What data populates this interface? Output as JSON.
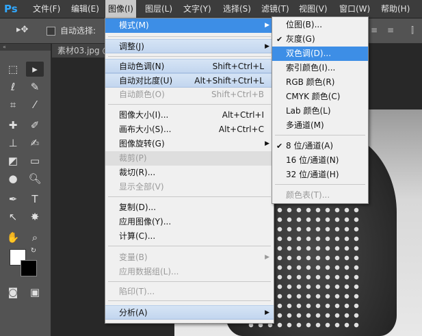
{
  "menubar": {
    "logo": "Ps",
    "items": [
      "文件(F)",
      "编辑(E)",
      "图像(I)",
      "图层(L)",
      "文字(Y)",
      "选择(S)",
      "滤镜(T)",
      "视图(V)",
      "窗口(W)",
      "帮助(H)"
    ]
  },
  "options": {
    "auto_select_label": "自动选择:"
  },
  "document": {
    "tab_label": "素材03.jpg @"
  },
  "image_menu": [
    {
      "label": "模式(M)",
      "shortcut": "",
      "arrow": "▶"
    },
    {
      "label": "调整(J)",
      "shortcut": "",
      "arrow": "▶"
    },
    {
      "label": "自动色调(N)",
      "shortcut": "Shift+Ctrl+L"
    },
    {
      "label": "自动对比度(U)",
      "shortcut": "Alt+Shift+Ctrl+L"
    },
    {
      "label": "自动颜色(O)",
      "shortcut": "Shift+Ctrl+B"
    },
    {
      "label": "图像大小(I)...",
      "shortcut": "Alt+Ctrl+I"
    },
    {
      "label": "画布大小(S)...",
      "shortcut": "Alt+Ctrl+C"
    },
    {
      "label": "图像旋转(G)",
      "shortcut": "",
      "arrow": "▶"
    },
    {
      "label": "裁剪(P)",
      "shortcut": ""
    },
    {
      "label": "裁切(R)...",
      "shortcut": ""
    },
    {
      "label": "显示全部(V)",
      "shortcut": ""
    },
    {
      "label": "复制(D)...",
      "shortcut": ""
    },
    {
      "label": "应用图像(Y)...",
      "shortcut": ""
    },
    {
      "label": "计算(C)...",
      "shortcut": ""
    },
    {
      "label": "变量(B)",
      "shortcut": "",
      "arrow": "▶"
    },
    {
      "label": "应用数据组(L)...",
      "shortcut": ""
    },
    {
      "label": "陷印(T)...",
      "shortcut": ""
    },
    {
      "label": "分析(A)",
      "shortcut": "",
      "arrow": "▶"
    }
  ],
  "mode_menu": [
    {
      "label": "位图(B)..."
    },
    {
      "label": "灰度(G)",
      "check": "✔"
    },
    {
      "label": "双色调(D)..."
    },
    {
      "label": "索引颜色(I)..."
    },
    {
      "label": "RGB 颜色(R)"
    },
    {
      "label": "CMYK 颜色(C)"
    },
    {
      "label": "Lab 颜色(L)"
    },
    {
      "label": "多通道(M)"
    },
    {
      "label": "8 位/通道(A)",
      "check": "✔"
    },
    {
      "label": "16 位/通道(N)"
    },
    {
      "label": "32 位/通道(H)"
    },
    {
      "label": "颜色表(T)..."
    }
  ]
}
